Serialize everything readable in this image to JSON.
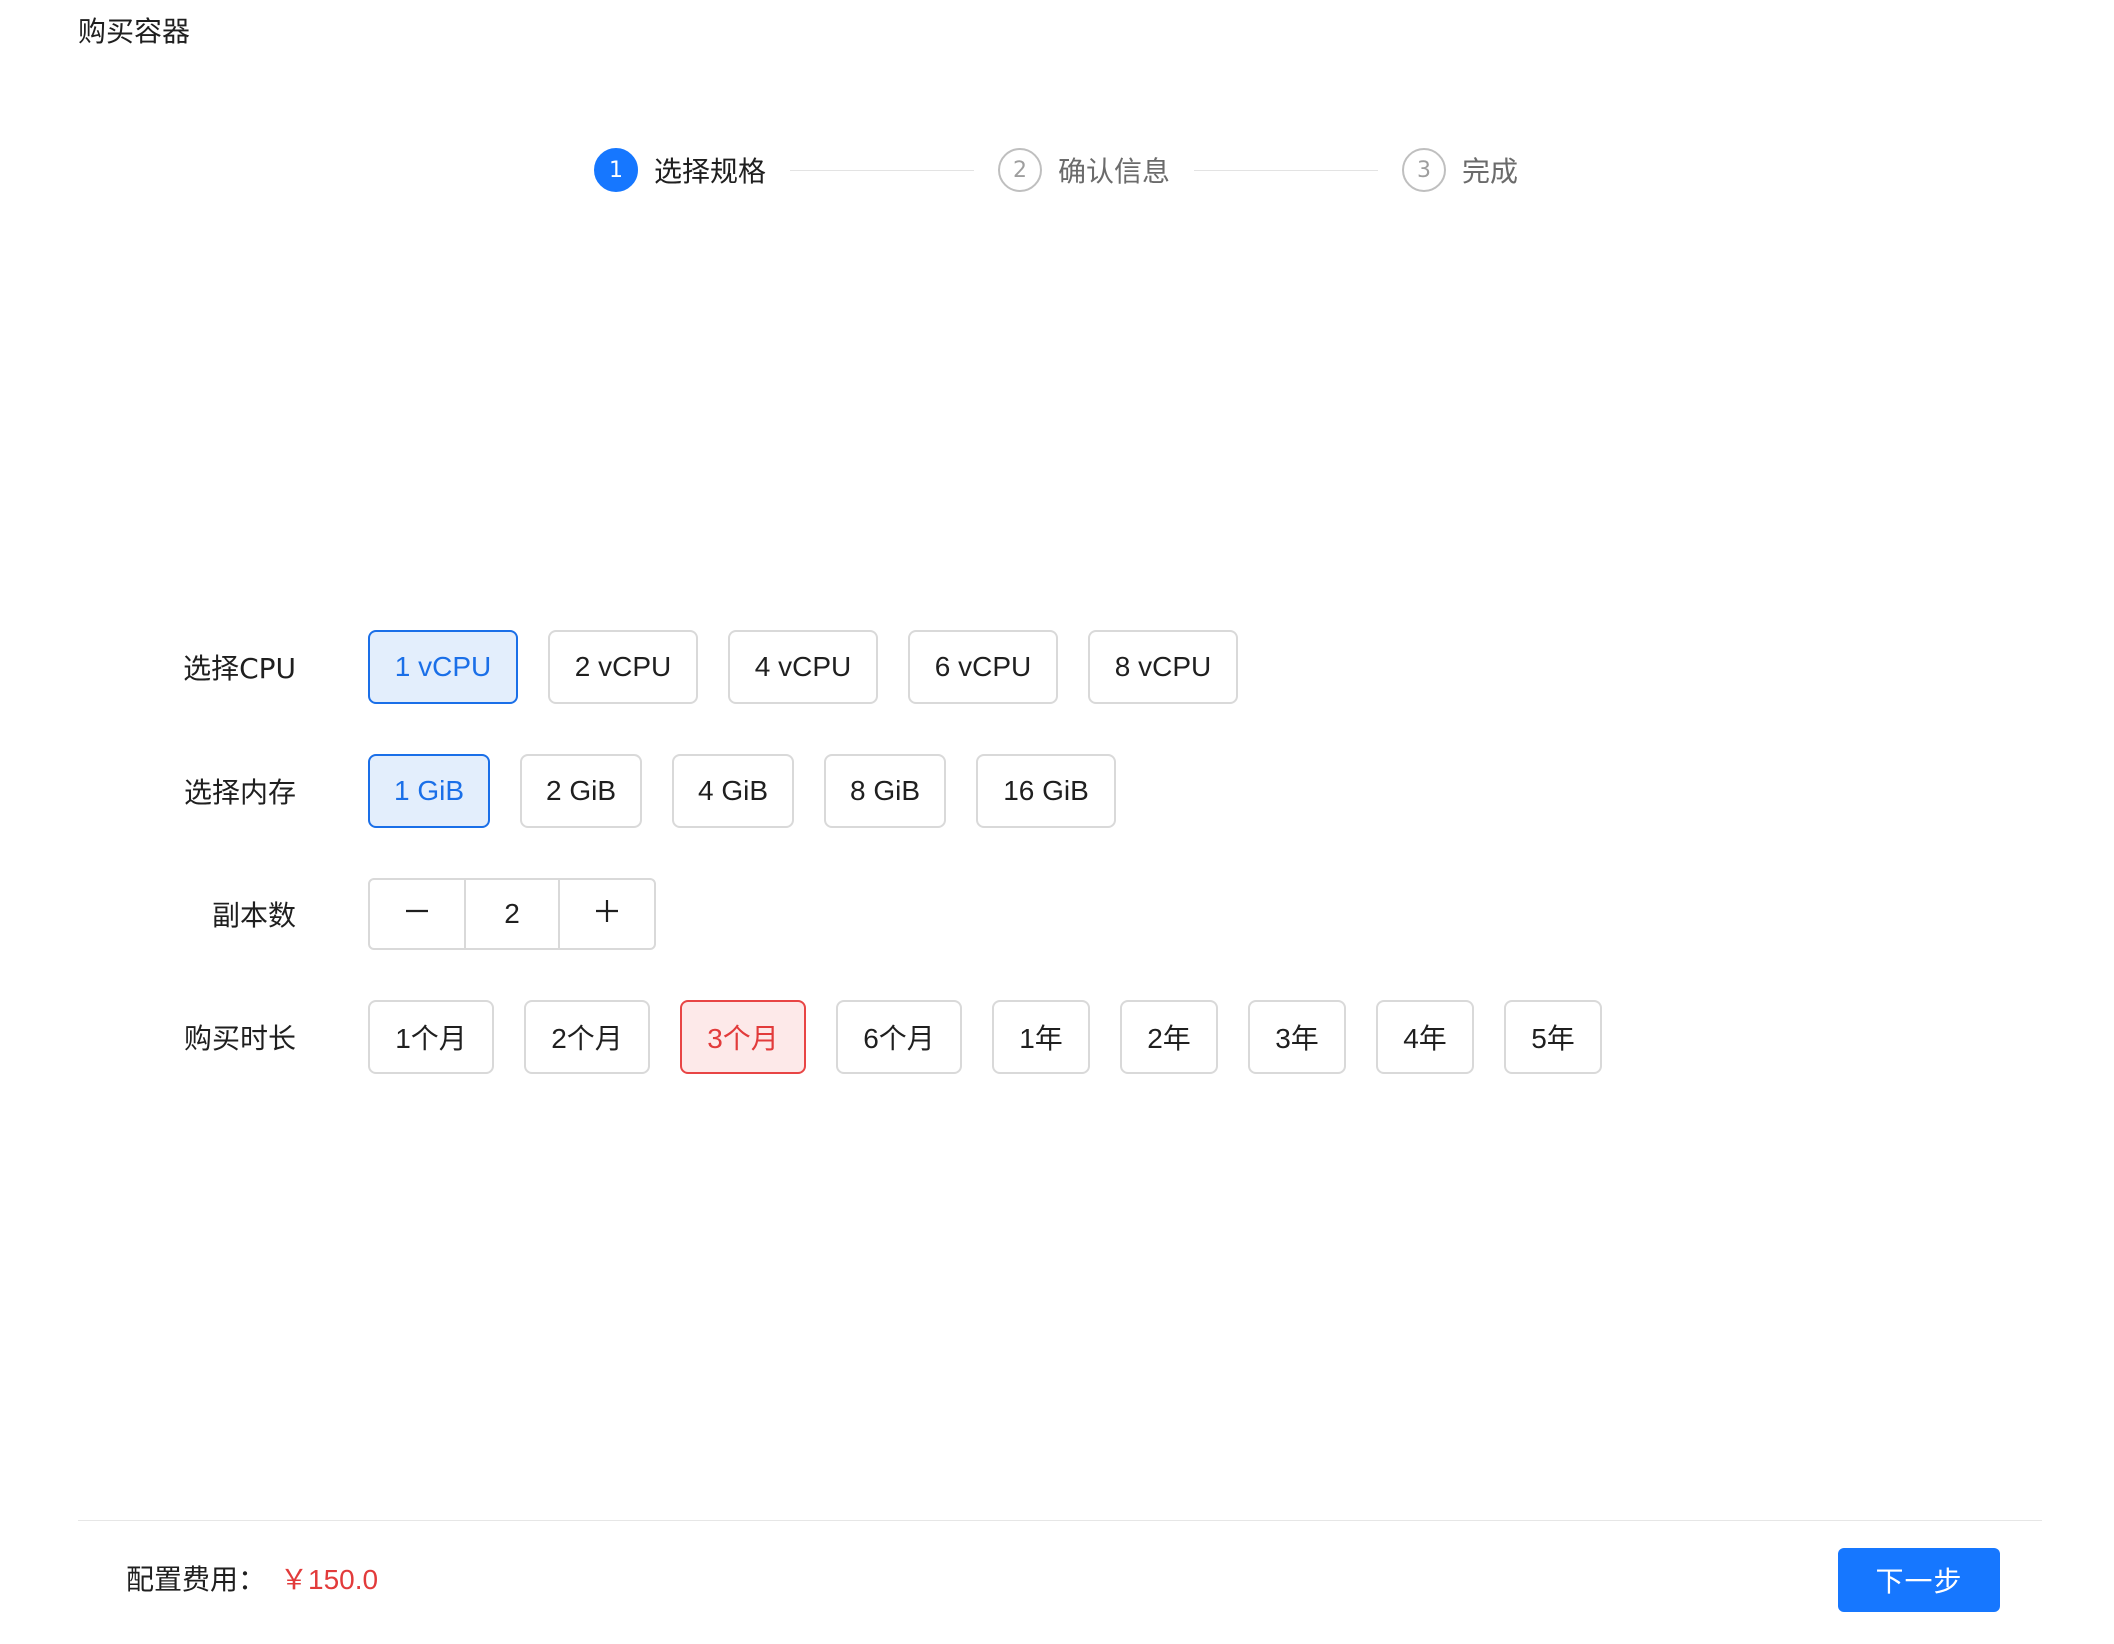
{
  "page": {
    "title": "购买容器"
  },
  "steps": [
    {
      "number": "1",
      "label": "选择规格",
      "active": true
    },
    {
      "number": "2",
      "label": "确认信息",
      "active": false
    },
    {
      "number": "3",
      "label": "完成",
      "active": false
    }
  ],
  "form": {
    "cpu": {
      "label": "选择CPU",
      "options": [
        "1 vCPU",
        "2 vCPU",
        "4 vCPU",
        "6 vCPU",
        "8 vCPU"
      ],
      "selected": "1 vCPU"
    },
    "memory": {
      "label": "选择内存",
      "options": [
        "1 GiB",
        "2 GiB",
        "4 GiB",
        "8 GiB",
        "16 GiB"
      ],
      "selected": "1 GiB"
    },
    "replicas": {
      "label": "副本数",
      "value": "2",
      "decrement_icon": "minus-icon",
      "increment_icon": "plus-icon"
    },
    "duration": {
      "label": "购买时长",
      "options": [
        "1个月",
        "2个月",
        "3个月",
        "6个月",
        "1年",
        "2年",
        "3年",
        "4年",
        "5年"
      ],
      "selected": "3个月"
    }
  },
  "footer": {
    "fee_label": "配置费用：",
    "fee_value": "￥150.0",
    "next_label": "下一步"
  },
  "colors": {
    "primary": "#1677ff",
    "selected_blue_bg": "#e3eefc",
    "selected_red": "#e23b3b",
    "selected_red_bg": "#fde9e9",
    "fee": "#e23b3b"
  }
}
